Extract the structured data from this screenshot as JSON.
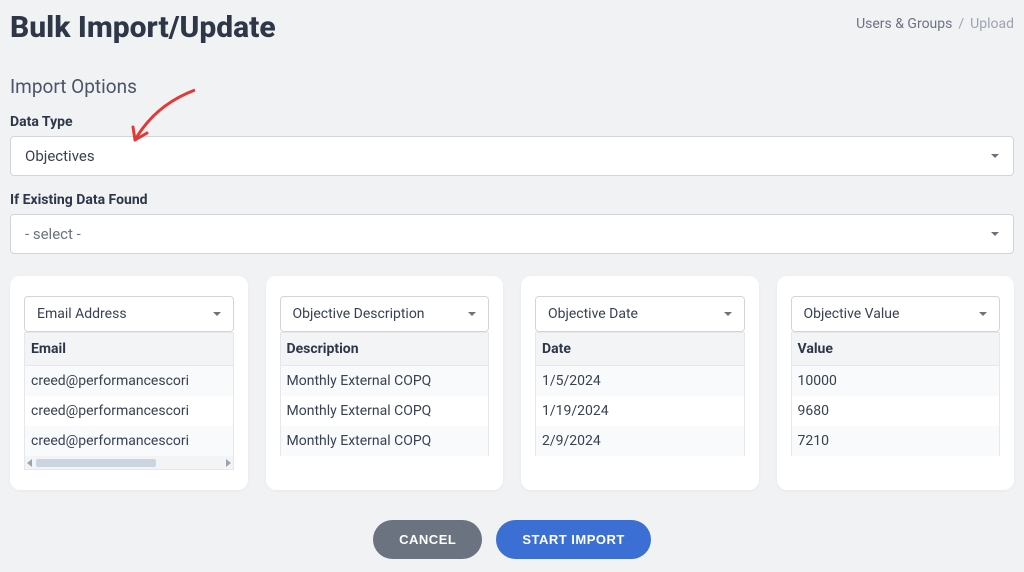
{
  "header": {
    "title": "Bulk Import/Update",
    "breadcrumb": {
      "parent": "Users & Groups",
      "separator": "/",
      "current": "Upload"
    }
  },
  "section": {
    "title": "Import Options"
  },
  "form": {
    "dataType": {
      "label": "Data Type",
      "value": "Objectives"
    },
    "ifExisting": {
      "label": "If Existing Data Found",
      "value": "- select -"
    }
  },
  "columns": [
    {
      "select": "Email Address",
      "header": "Email",
      "rows": [
        "creed@performancescori",
        "creed@performancescori",
        "creed@performancescori"
      ]
    },
    {
      "select": "Objective Description",
      "header": "Description",
      "rows": [
        "Monthly External COPQ",
        "Monthly External COPQ",
        "Monthly External COPQ"
      ]
    },
    {
      "select": "Objective Date",
      "header": "Date",
      "rows": [
        "1/5/2024",
        "1/19/2024",
        "2/9/2024"
      ]
    },
    {
      "select": "Objective Value",
      "header": "Value",
      "rows": [
        "10000",
        "9680",
        "7210"
      ]
    }
  ],
  "buttons": {
    "cancel": "CANCEL",
    "start": "START IMPORT"
  }
}
